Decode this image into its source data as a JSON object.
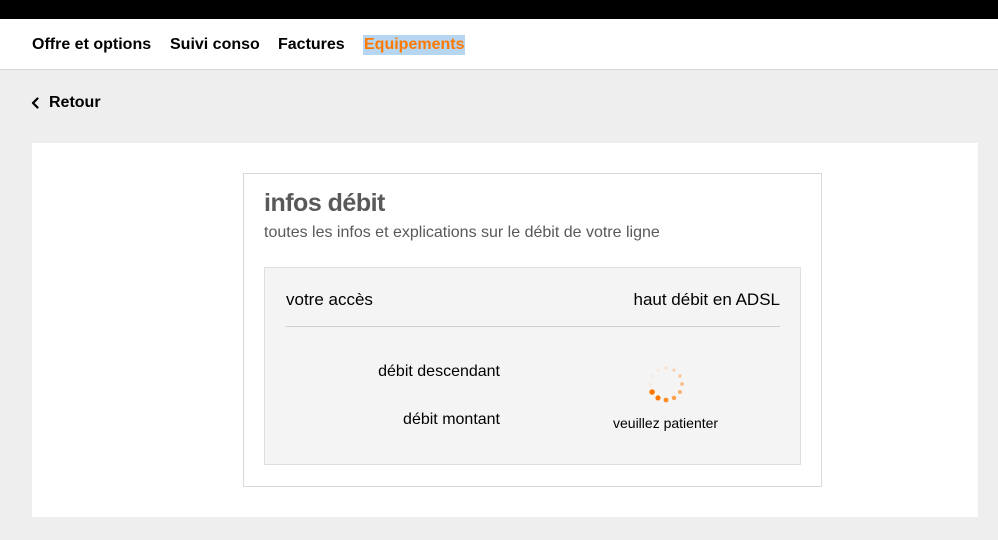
{
  "nav": {
    "items": [
      {
        "label": "Offre et options"
      },
      {
        "label": "Suivi conso"
      },
      {
        "label": "Factures"
      },
      {
        "label": "Equipements"
      }
    ]
  },
  "back": {
    "label": "Retour",
    "icon": "chevron-left-icon"
  },
  "card": {
    "title": "infos débit",
    "subtitle": "toutes les infos et explications sur le débit de votre ligne",
    "access_label": "votre accès",
    "access_value": "haut débit en ADSL",
    "download_label": "débit descendant",
    "upload_label": "débit montant",
    "loading_text": "veuillez patienter",
    "loading_icon": "spinner-icon"
  },
  "colors": {
    "accent": "#ff7900",
    "selection": "#b5d5f0"
  }
}
